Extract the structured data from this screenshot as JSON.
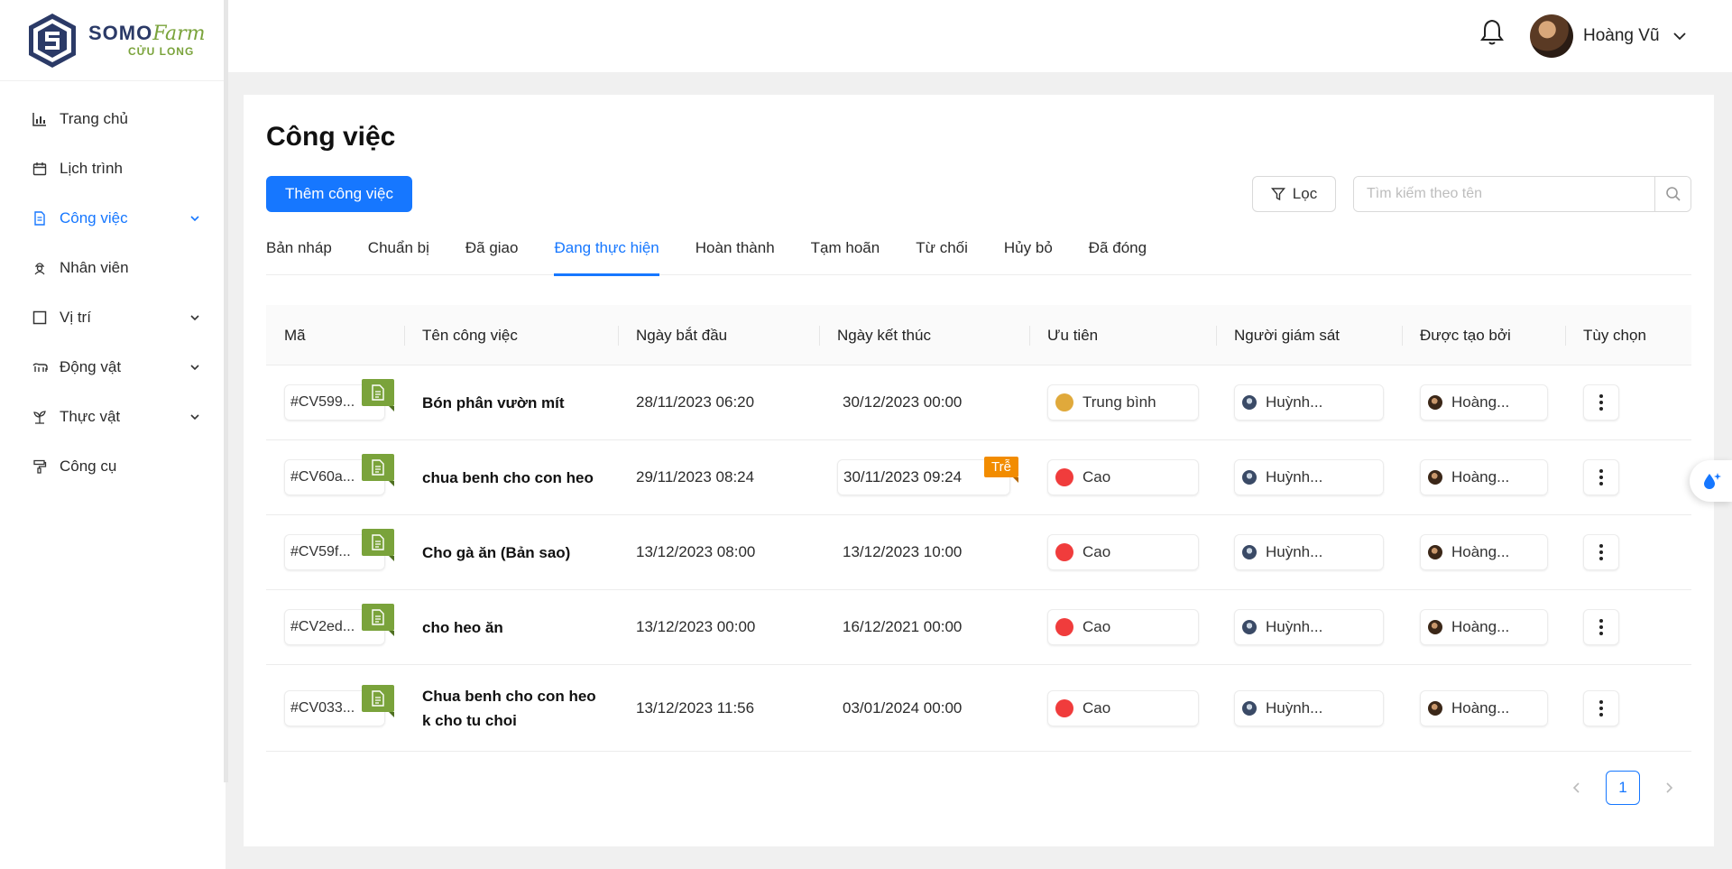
{
  "brand": {
    "name_part1": "SOMO",
    "name_part2": "Farm",
    "subtitle": "CỬU LONG",
    "badge": "SOMO GROUP"
  },
  "sidebar": {
    "items": [
      {
        "label": "Trang chủ",
        "icon": "bar-chart-icon",
        "expandable": false
      },
      {
        "label": "Lịch trình",
        "icon": "calendar-icon",
        "expandable": false
      },
      {
        "label": "Công việc",
        "icon": "document-icon",
        "expandable": true,
        "active": true
      },
      {
        "label": "Nhân viên",
        "icon": "worker-icon",
        "expandable": false
      },
      {
        "label": "Vị trí",
        "icon": "square-icon",
        "expandable": true
      },
      {
        "label": "Động vật",
        "icon": "animal-icon",
        "expandable": true
      },
      {
        "label": "Thực vật",
        "icon": "plant-icon",
        "expandable": true
      },
      {
        "label": "Công cụ",
        "icon": "paint-roller-icon",
        "expandable": false
      }
    ]
  },
  "header": {
    "user_name": "Hoàng Vũ"
  },
  "page": {
    "title": "Công việc",
    "add_button": "Thêm công việc",
    "filter_button": "Lọc",
    "search_placeholder": "Tìm kiếm theo tên"
  },
  "tabs": [
    {
      "label": "Bản nháp"
    },
    {
      "label": "Chuẩn bị"
    },
    {
      "label": "Đã giao"
    },
    {
      "label": "Đang thực hiện",
      "active": true
    },
    {
      "label": "Hoàn thành"
    },
    {
      "label": "Tạm hoãn"
    },
    {
      "label": "Từ chối"
    },
    {
      "label": "Hủy bỏ"
    },
    {
      "label": "Đã đóng"
    }
  ],
  "table": {
    "columns": [
      "Mã",
      "Tên công việc",
      "Ngày bắt đầu",
      "Ngày kết thúc",
      "Ưu tiên",
      "Người giám sát",
      "Được tạo bởi",
      "Tùy chọn"
    ],
    "rows": [
      {
        "code": "#CV599...",
        "name": "Bón phân vườn mít",
        "start": "28/11/2023 06:20",
        "end": "30/12/2023 00:00",
        "late": false,
        "priority": "Trung bình",
        "priority_color": "#e0a93b",
        "supervisor": "Huỳnh...",
        "creator": "Hoàng..."
      },
      {
        "code": "#CV60a...",
        "name": "chua benh cho con heo",
        "start": "29/11/2023 08:24",
        "end": "30/11/2023 09:24",
        "late": true,
        "late_label": "Trễ",
        "priority": "Cao",
        "priority_color": "#f03c3c",
        "supervisor": "Huỳnh...",
        "creator": "Hoàng..."
      },
      {
        "code": "#CV59f...",
        "name": "Cho gà ăn (Bản sao)",
        "start": "13/12/2023 08:00",
        "end": "13/12/2023 10:00",
        "late": false,
        "priority": "Cao",
        "priority_color": "#f03c3c",
        "supervisor": "Huỳnh...",
        "creator": "Hoàng..."
      },
      {
        "code": "#CV2ed...",
        "name": "cho heo ăn",
        "start": "13/12/2023 00:00",
        "end": "16/12/2021 00:00",
        "late": false,
        "priority": "Cao",
        "priority_color": "#f03c3c",
        "supervisor": "Huỳnh...",
        "creator": "Hoàng..."
      },
      {
        "code": "#CV033...",
        "name": "Chua benh cho con heo k cho tu choi",
        "start": "13/12/2023 11:56",
        "end": "03/01/2024 00:00",
        "late": false,
        "priority": "Cao",
        "priority_color": "#f03c3c",
        "supervisor": "Huỳnh...",
        "creator": "Hoàng..."
      }
    ]
  },
  "pagination": {
    "current_page": "1"
  }
}
